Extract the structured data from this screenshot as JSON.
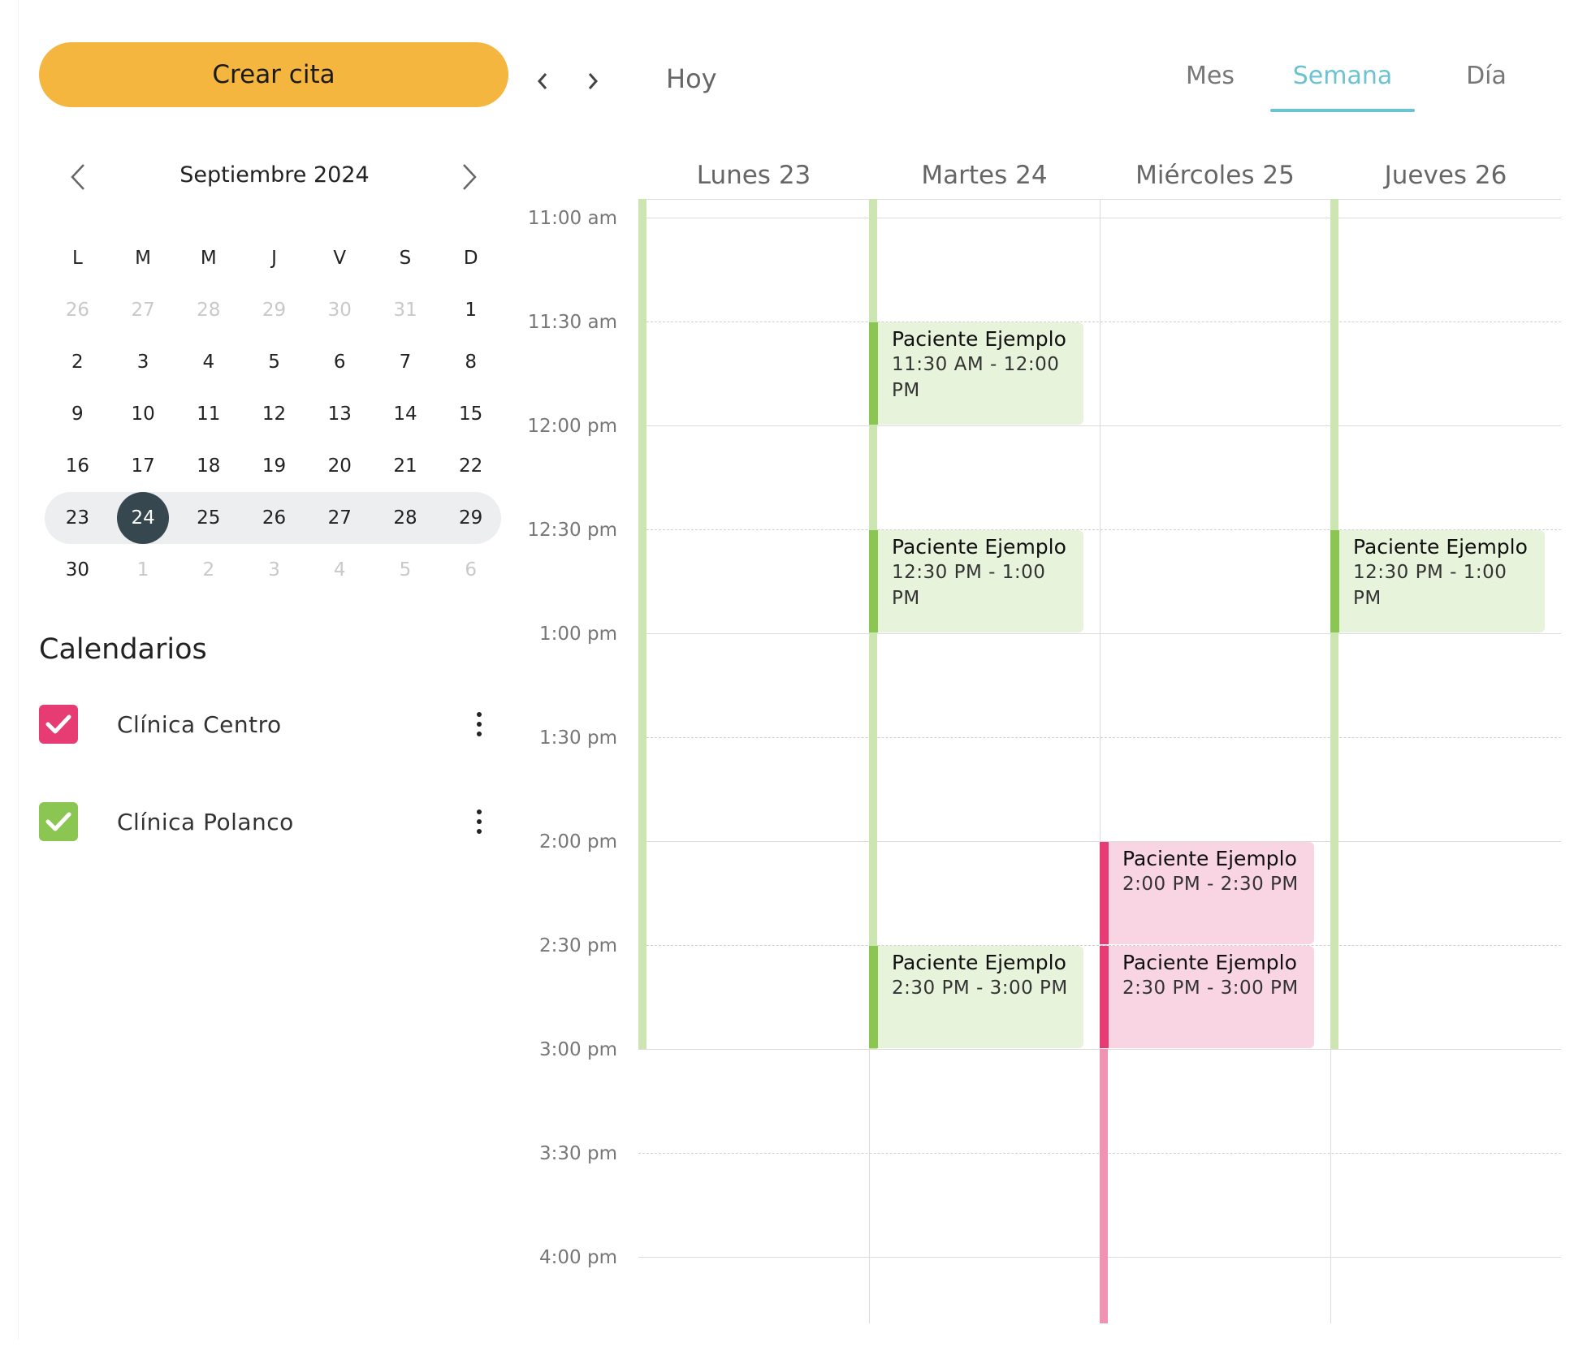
{
  "sidebar": {
    "create_label": "Crear cita",
    "month_title": "Septiembre 2024",
    "weekday_headers": [
      "L",
      "M",
      "M",
      "J",
      "V",
      "S",
      "D"
    ],
    "weeks": [
      [
        "26",
        "27",
        "28",
        "29",
        "30",
        "31",
        "1"
      ],
      [
        "2",
        "3",
        "4",
        "5",
        "6",
        "7",
        "8"
      ],
      [
        "9",
        "10",
        "11",
        "12",
        "13",
        "14",
        "15"
      ],
      [
        "16",
        "17",
        "18",
        "19",
        "20",
        "21",
        "22"
      ],
      [
        "23",
        "24",
        "25",
        "26",
        "27",
        "28",
        "29"
      ],
      [
        "30",
        "1",
        "2",
        "3",
        "4",
        "5",
        "6"
      ]
    ],
    "selected_day": "24",
    "calendars_title": "Calendarios",
    "calendars": [
      {
        "name": "Clínica Centro",
        "color": "#e73b74",
        "checked": true
      },
      {
        "name": "Clínica Polanco",
        "color": "#8cc652",
        "checked": true
      }
    ]
  },
  "toolbar": {
    "today_label": "Hoy",
    "views": [
      "Mes",
      "Semana",
      "Día"
    ],
    "active_view": "Semana"
  },
  "week": {
    "days": [
      "Lunes 23",
      "Martes 24",
      "Miércoles 25",
      "Jueves 26"
    ],
    "times": [
      "11:00 am",
      "11:30 am",
      "12:00 pm",
      "12:30 pm",
      "1:00 pm",
      "1:30 pm",
      "2:00 pm",
      "2:30 pm",
      "3:00 pm",
      "3:30 pm",
      "4:00 pm"
    ],
    "events": [
      {
        "title": "Paciente Ejemplo",
        "time_line1": "11:30 AM - 12:00",
        "time_line2": "PM"
      },
      {
        "title": "Paciente Ejemplo",
        "time_line1": "12:30 PM - 1:00 PM",
        "time_line2": ""
      },
      {
        "title": "Paciente Ejemplo",
        "time_line1": "2:30 PM - 3:00 PM",
        "time_line2": ""
      },
      {
        "title": "Paciente Ejemplo",
        "time_line1": "2:00 PM - 2:30 PM",
        "time_line2": ""
      },
      {
        "title": "Paciente Ejemplo",
        "time_line1": "2:30 PM - 3:00 PM",
        "time_line2": ""
      },
      {
        "title": "Paciente Ejemplo",
        "time_line1": "12:30 PM - 1:00 PM",
        "time_line2": ""
      }
    ]
  },
  "colors": {
    "accent_yellow": "#f4b63f",
    "active_tab": "#6bc3d2",
    "polanco_green": "#8cc652",
    "centro_pink": "#e73b74"
  }
}
